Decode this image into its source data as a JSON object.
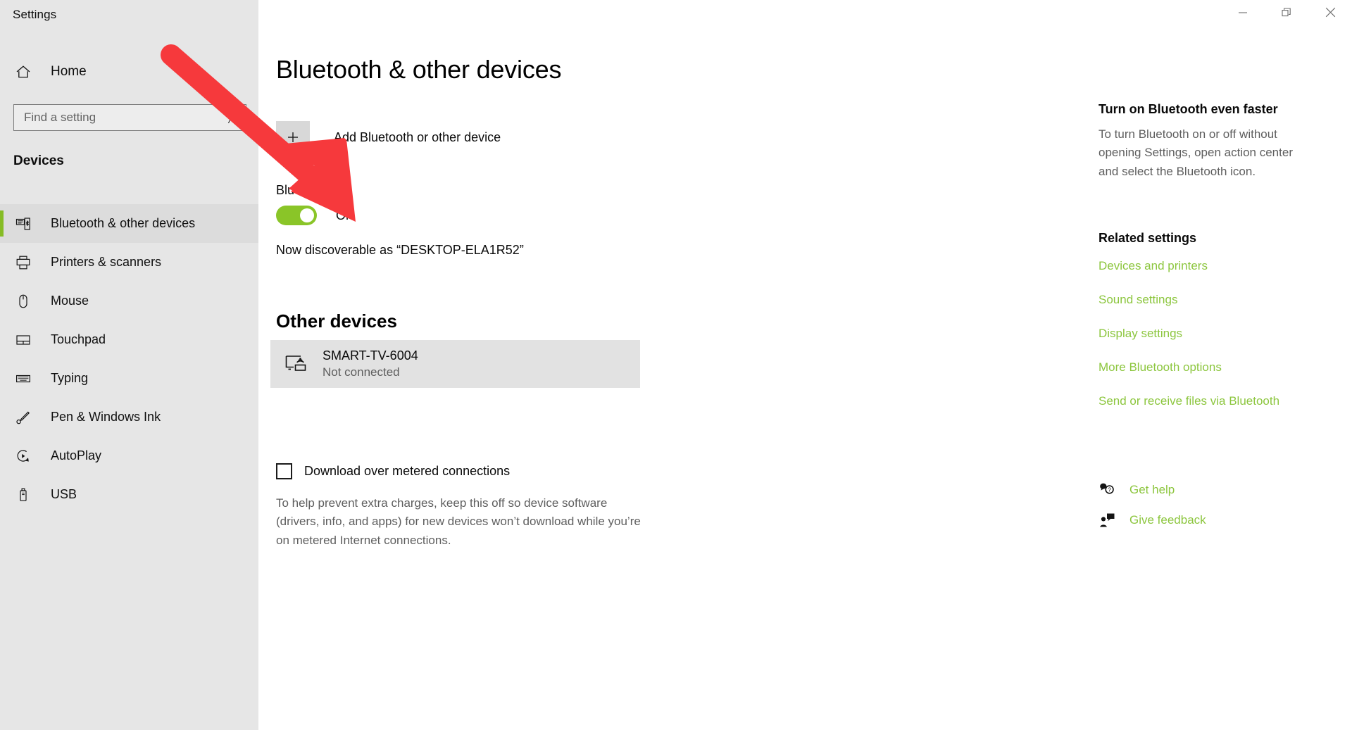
{
  "window": {
    "app_title": "Settings",
    "controls": [
      {
        "name": "minimize",
        "glyph": "minimize-icon"
      },
      {
        "name": "restore",
        "glyph": "restore-icon"
      },
      {
        "name": "close",
        "glyph": "close-icon"
      }
    ]
  },
  "sidebar": {
    "home_label": "Home",
    "home_icon": "home-icon",
    "search": {
      "placeholder": "Find a setting",
      "value": "",
      "icon": "search-icon"
    },
    "group_header": "Devices",
    "items": [
      {
        "label": "Bluetooth & other devices",
        "icon": "bluetooth-devices-icon",
        "selected": true
      },
      {
        "label": "Printers & scanners",
        "icon": "printer-icon",
        "selected": false
      },
      {
        "label": "Mouse",
        "icon": "mouse-icon",
        "selected": false
      },
      {
        "label": "Touchpad",
        "icon": "touchpad-icon",
        "selected": false
      },
      {
        "label": "Typing",
        "icon": "keyboard-icon",
        "selected": false
      },
      {
        "label": "Pen & Windows Ink",
        "icon": "pen-icon",
        "selected": false
      },
      {
        "label": "AutoPlay",
        "icon": "autoplay-icon",
        "selected": false
      },
      {
        "label": "USB",
        "icon": "usb-icon",
        "selected": false
      }
    ],
    "accent_color": "#86bc25"
  },
  "main": {
    "page_title": "Bluetooth & other devices",
    "add_device": {
      "label": "Add Bluetooth or other device",
      "icon": "plus-icon"
    },
    "bluetooth": {
      "heading": "Bluetooth",
      "state_label": "On",
      "toggle_on": true,
      "toggle_color": "#8ac528",
      "discoverable_text": "Now discoverable as “DESKTOP-ELA1R52”"
    },
    "other_devices": {
      "title": "Other devices",
      "devices": [
        {
          "name": "SMART-TV-6004",
          "status": "Not connected",
          "icon": "cast-display-icon"
        }
      ]
    },
    "metered": {
      "checkbox_label": "Download over metered connections",
      "checked": false,
      "description": "To help prevent extra charges, keep this off so device software (drivers, info, and apps) for new devices won’t download while you’re on metered Internet connections."
    }
  },
  "right_panel": {
    "tip_title": "Turn on Bluetooth even faster",
    "tip_body": "To turn Bluetooth on or off without opening Settings, open action center and select the Bluetooth icon.",
    "related_title": "Related settings",
    "link_color": "#8cc63e",
    "links": [
      "Devices and printers",
      "Sound settings",
      "Display settings",
      "More Bluetooth options",
      "Send or receive files via Bluetooth"
    ],
    "support": [
      {
        "label": "Get help",
        "icon": "help-icon"
      },
      {
        "label": "Give feedback",
        "icon": "feedback-icon"
      }
    ]
  },
  "annotation": {
    "arrow_color": "#f6393c",
    "type": "arrow",
    "points_to": "bluetooth-toggle"
  }
}
